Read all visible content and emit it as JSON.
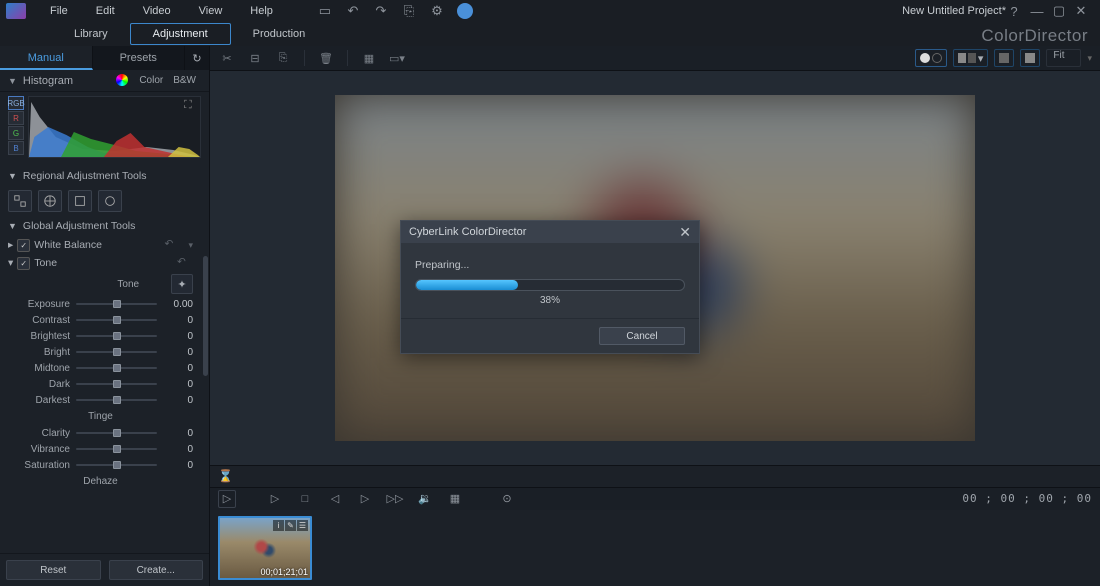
{
  "menu": {
    "items": [
      "File",
      "Edit",
      "Video",
      "View",
      "Help"
    ]
  },
  "project_title": "New Untitled Project*",
  "brand": "ColorDirector",
  "top_tabs": {
    "items": [
      "Library",
      "Adjustment",
      "Production"
    ],
    "active": 1
  },
  "side_tabs": {
    "items": [
      "Manual",
      "Presets"
    ],
    "active": 0
  },
  "histogram": {
    "title": "Histogram",
    "color_tab": "Color",
    "bw_tab": "B&W",
    "channels": [
      "RGB",
      "R",
      "G",
      "B"
    ]
  },
  "regional": {
    "title": "Regional Adjustment Tools"
  },
  "global": {
    "title": "Global Adjustment Tools"
  },
  "white_balance": {
    "label": "White Balance"
  },
  "tone": {
    "label": "Tone",
    "group": "Tone",
    "tinge_group": "Tinge",
    "dehaze_group": "Dehaze",
    "sliders": [
      {
        "label": "Exposure",
        "value": "0.00",
        "pos": 50
      },
      {
        "label": "Contrast",
        "value": "0",
        "pos": 50
      },
      {
        "label": "Brightest",
        "value": "0",
        "pos": 50
      },
      {
        "label": "Bright",
        "value": "0",
        "pos": 50
      },
      {
        "label": "Midtone",
        "value": "0",
        "pos": 50
      },
      {
        "label": "Dark",
        "value": "0",
        "pos": 50
      },
      {
        "label": "Darkest",
        "value": "0",
        "pos": 50
      }
    ],
    "tinge_sliders": [
      {
        "label": "Clarity",
        "value": "0",
        "pos": 50
      },
      {
        "label": "Vibrance",
        "value": "0",
        "pos": 50
      },
      {
        "label": "Saturation",
        "value": "0",
        "pos": 50
      }
    ]
  },
  "bottom": {
    "reset": "Reset",
    "create": "Create..."
  },
  "zoom": "Fit",
  "playback": {
    "timecode": "00 ; 00 ; 00 ; 00"
  },
  "clip": {
    "duration": "00;01;21;01"
  },
  "dialog": {
    "title": "CyberLink ColorDirector",
    "label": "Preparing...",
    "percent": 38,
    "percent_label": "38%",
    "cancel": "Cancel"
  }
}
